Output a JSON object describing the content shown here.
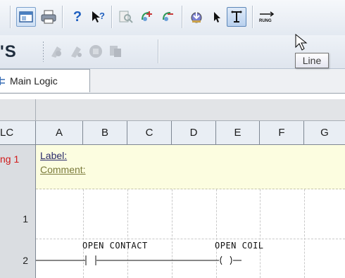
{
  "tooltip": {
    "text": "Line"
  },
  "toolbar": {
    "left_label": "'S",
    "buttons": [
      "view-icon",
      "print-icon",
      "help-icon",
      "context-help-icon",
      "zoom-page-icon",
      "zoom-in-icon",
      "zoom-out-icon",
      "download-icon",
      "select-pointer-icon",
      "line-tool-icon",
      "rung-icon"
    ],
    "rung_label": "RUNG"
  },
  "tab": {
    "label": "Main Logic"
  },
  "columns": {
    "row_header": "LC",
    "letters": [
      "A",
      "B",
      "C",
      "D",
      "E",
      "F",
      "G"
    ]
  },
  "rung": {
    "label": "ng 1",
    "label_field": "Label:",
    "comment_field": "Comment:"
  },
  "rows": [
    "1",
    "2"
  ],
  "instructions": {
    "contact_label": "OPEN CONTACT",
    "coil_label": "OPEN COIL"
  }
}
